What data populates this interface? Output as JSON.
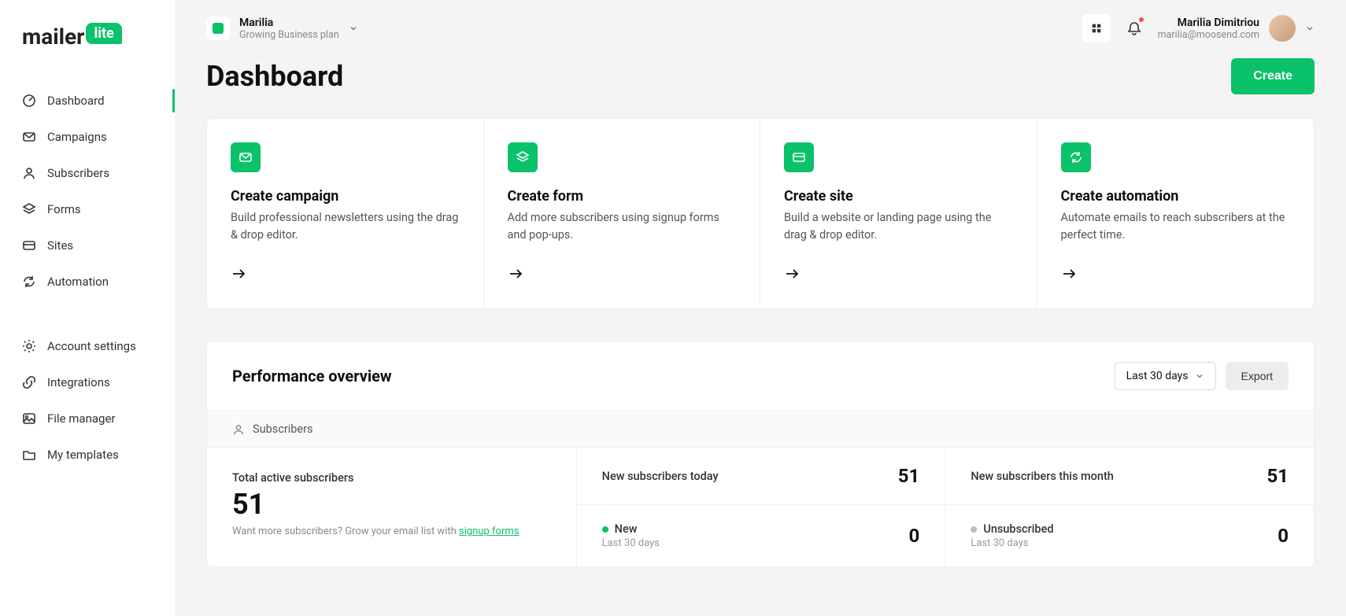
{
  "brand": {
    "name1": "mailer",
    "name2": "lite"
  },
  "sidebar": {
    "primary": [
      {
        "label": "Dashboard",
        "icon": "gauge",
        "active": true
      },
      {
        "label": "Campaigns",
        "icon": "mail"
      },
      {
        "label": "Subscribers",
        "icon": "user"
      },
      {
        "label": "Forms",
        "icon": "stack"
      },
      {
        "label": "Sites",
        "icon": "site"
      },
      {
        "label": "Automation",
        "icon": "refresh"
      }
    ],
    "secondary": [
      {
        "label": "Account settings",
        "icon": "gear"
      },
      {
        "label": "Integrations",
        "icon": "link"
      },
      {
        "label": "File manager",
        "icon": "image"
      },
      {
        "label": "My templates",
        "icon": "folder"
      }
    ]
  },
  "topbar": {
    "account_name": "Marilia",
    "plan": "Growing Business plan",
    "user_name": "Marilia Dimitriou",
    "user_email": "marilia@moosend.com"
  },
  "header": {
    "title": "Dashboard",
    "create_label": "Create"
  },
  "cards": [
    {
      "title": "Create campaign",
      "desc": "Build professional newsletters using the drag & drop editor.",
      "icon": "mail"
    },
    {
      "title": "Create form",
      "desc": "Add more subscribers using signup forms and pop-ups.",
      "icon": "stack"
    },
    {
      "title": "Create site",
      "desc": "Build a website or landing page using the drag & drop editor.",
      "icon": "site"
    },
    {
      "title": "Create automation",
      "desc": "Automate emails to reach subscribers at the perfect time.",
      "icon": "refresh"
    }
  ],
  "performance": {
    "title": "Performance overview",
    "range": "Last 30 days",
    "export_label": "Export",
    "tab_label": "Subscribers",
    "total_label": "Total active subscribers",
    "total_value": "51",
    "cta_prefix": "Want more subscribers? ",
    "cta_mid": "Grow your email list with ",
    "cta_link": "signup forms",
    "metrics_col1": [
      {
        "name": "New subscribers today",
        "value": "51"
      },
      {
        "name": "New",
        "period": "Last 30 days",
        "value": "0",
        "dot": "green"
      }
    ],
    "metrics_col2": [
      {
        "name": "New subscribers this month",
        "value": "51"
      },
      {
        "name": "Unsubscribed",
        "period": "Last 30 days",
        "value": "0",
        "dot": "gray"
      }
    ]
  }
}
